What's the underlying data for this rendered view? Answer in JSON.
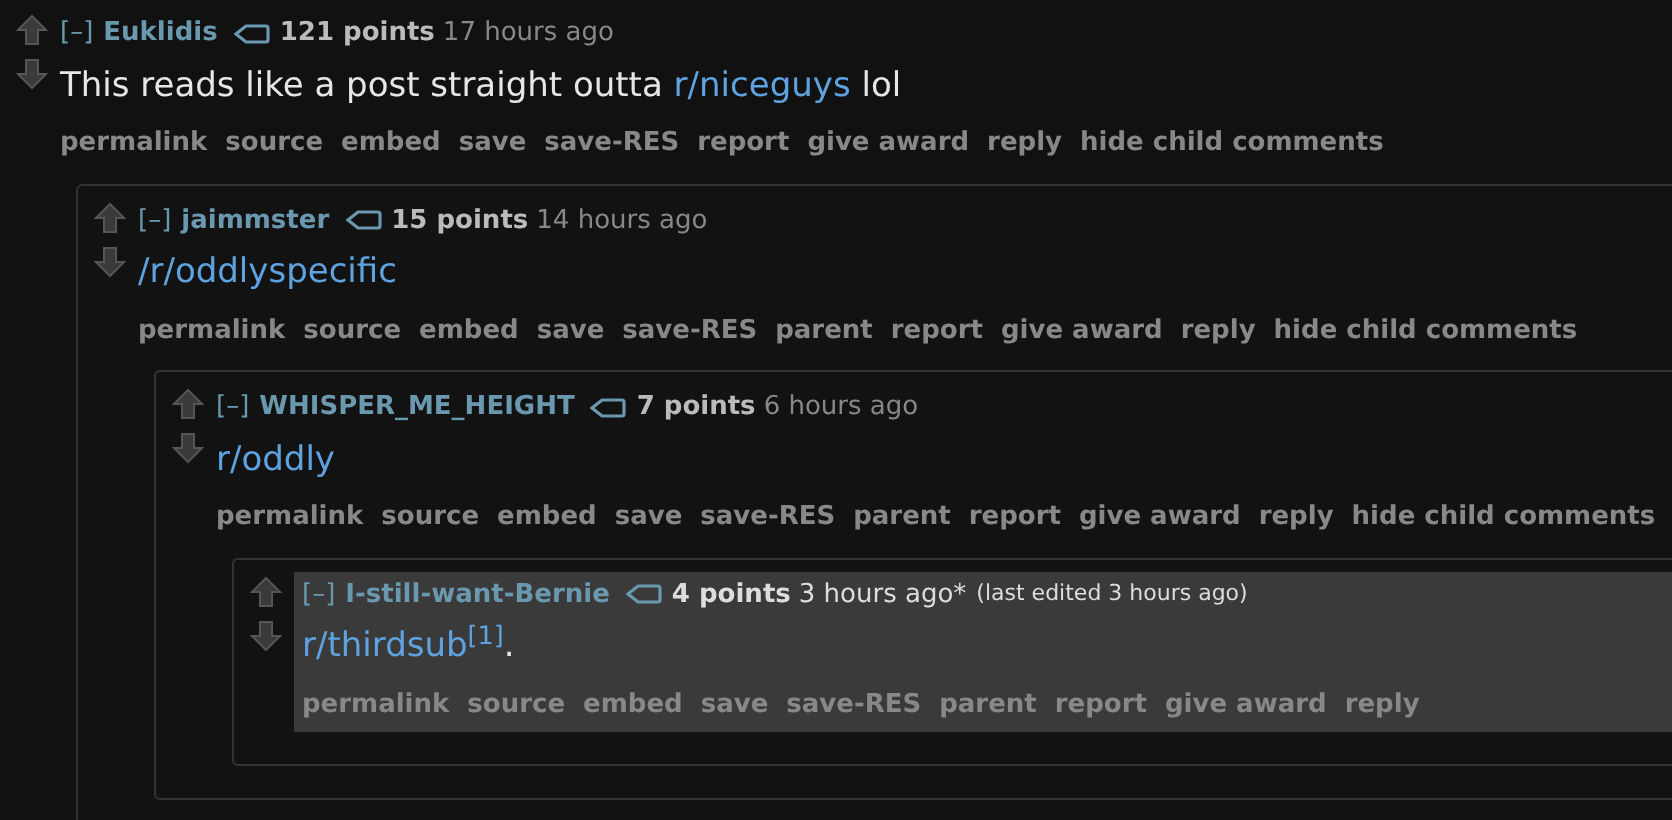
{
  "comment": {
    "collapse": "[–]",
    "author": "Euklidis",
    "points": "121 points",
    "time": "17 hours ago",
    "highlighted": false,
    "body": [
      {
        "kind": "text",
        "text": "This reads like a post straight outta "
      },
      {
        "kind": "link",
        "text": "r/niceguys"
      },
      {
        "kind": "text",
        "text": " lol"
      }
    ],
    "actions": [
      "permalink",
      "source",
      "embed",
      "save",
      "save-RES",
      "report",
      "give award",
      "reply",
      "hide child comments"
    ],
    "children": [
      {
        "collapse": "[–]",
        "author": "jaimmster",
        "points": "15 points",
        "time": "14 hours ago",
        "highlighted": false,
        "body": [
          {
            "kind": "link",
            "text": "/r/oddlyspecific"
          }
        ],
        "actions": [
          "permalink",
          "source",
          "embed",
          "save",
          "save-RES",
          "parent",
          "report",
          "give award",
          "reply",
          "hide child comments"
        ],
        "children": [
          {
            "collapse": "[–]",
            "author": "WHISPER_ME_HEIGHT",
            "points": "7 points",
            "time": "6 hours ago",
            "highlighted": false,
            "body": [
              {
                "kind": "link",
                "text": "r/oddly"
              }
            ],
            "actions": [
              "permalink",
              "source",
              "embed",
              "save",
              "save-RES",
              "parent",
              "report",
              "give award",
              "reply",
              "hide child comments"
            ],
            "children": [
              {
                "collapse": "[–]",
                "author": "I-still-want-Bernie",
                "points": "4 points",
                "time": "3 hours ago*",
                "edited": "(last edited 3 hours ago)",
                "highlighted": true,
                "body": [
                  {
                    "kind": "link",
                    "text": "r/thirdsub$^{[1]}$"
                  },
                  {
                    "kind": "text",
                    "text": "."
                  }
                ],
                "actions": [
                  "permalink",
                  "source",
                  "embed",
                  "save",
                  "save-RES",
                  "parent",
                  "report",
                  "give award",
                  "reply"
                ]
              }
            ]
          }
        ]
      }
    ]
  }
}
